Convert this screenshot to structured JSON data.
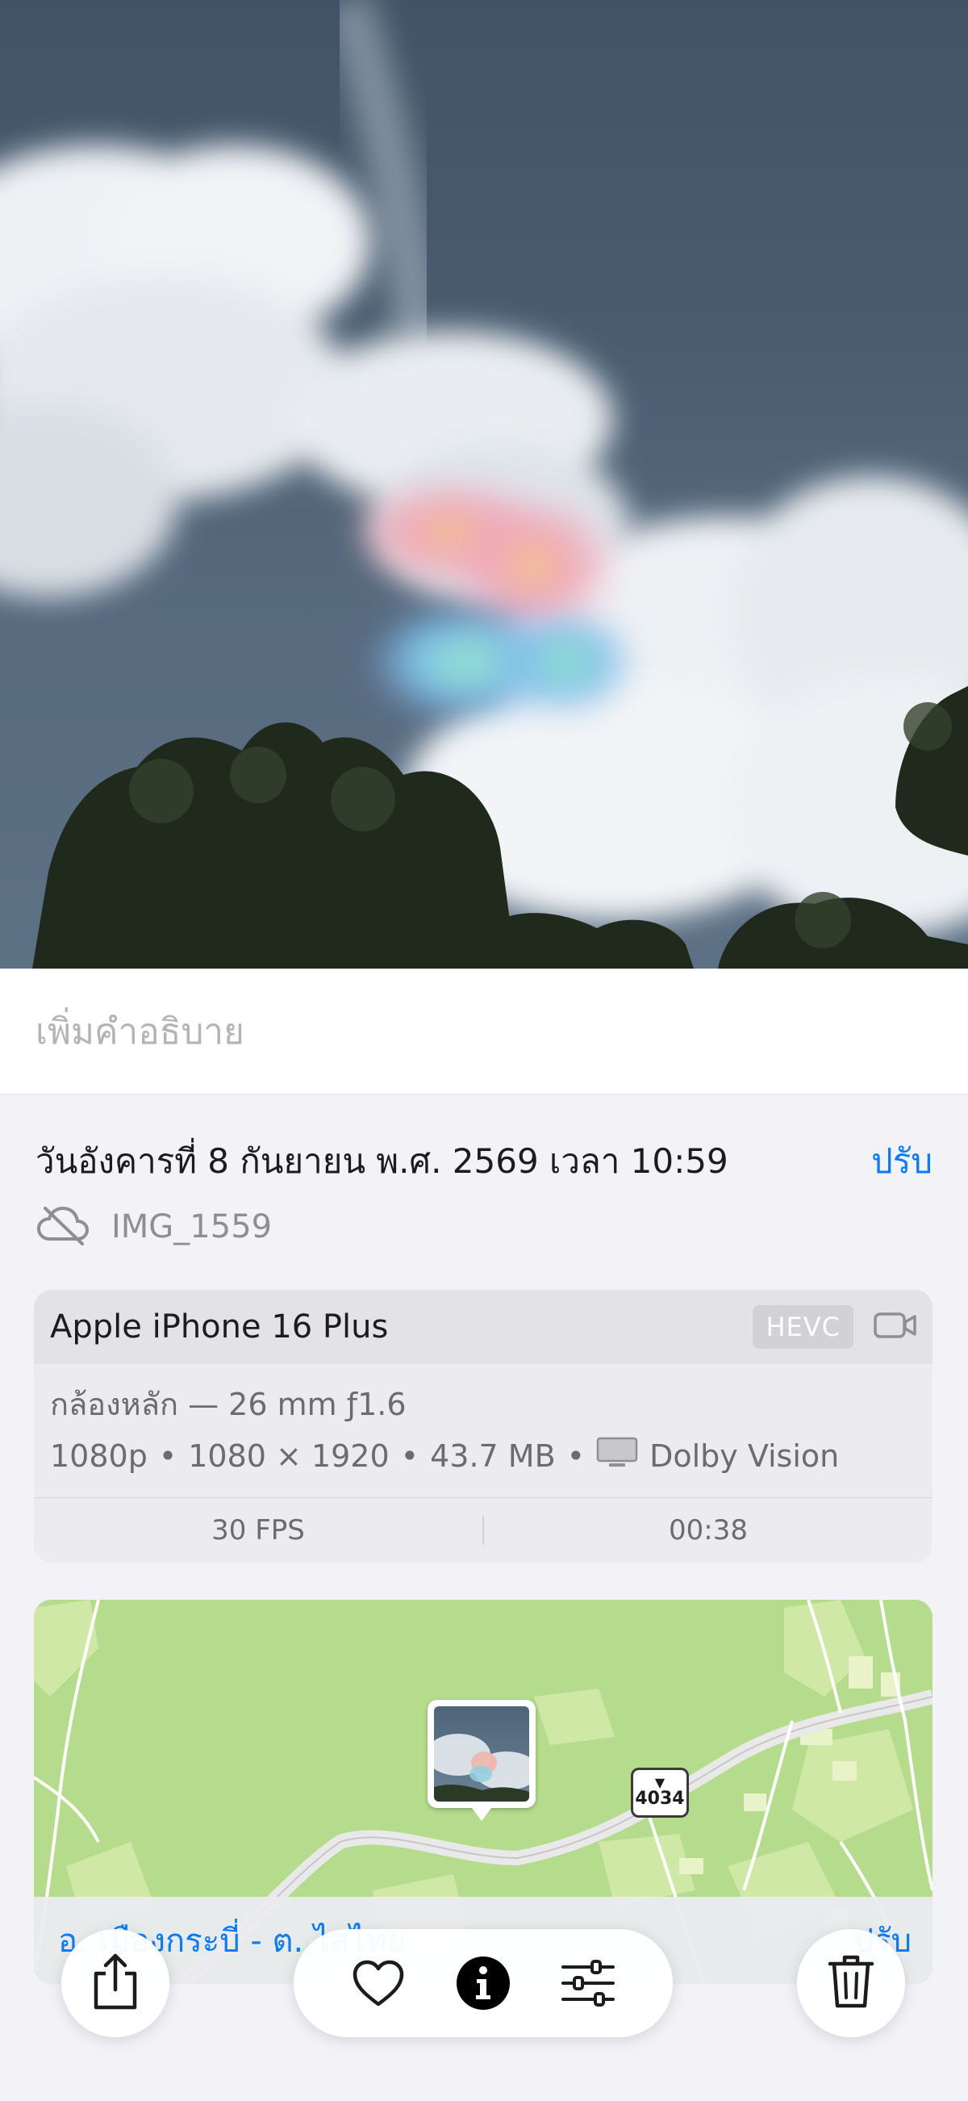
{
  "caption": {
    "placeholder": "เพิ่มคำอธิบาย"
  },
  "header": {
    "date": "วันอังคารที่ 8 กันยายน พ.ศ. 2569 เวลา 10:59",
    "adjust_label": "ปรับ",
    "filename": "IMG_1559",
    "cloud_icon": "cloud-slash-icon"
  },
  "camera": {
    "device": "Apple iPhone 16 Plus",
    "format_badge": "HEVC",
    "video_icon": "video-camera-icon",
    "lens": "กล้องหลัก — 26 mm ƒ1.6",
    "resolution": "1080p",
    "dimensions": "1080 × 1920",
    "size": "43.7 MB",
    "hdr": "Dolby Vision",
    "hdr_icon": "monitor-icon",
    "bullet": "•",
    "fps": "30 FPS",
    "duration": "00:38"
  },
  "map": {
    "road_number": "4034",
    "place": "อ. เมืองกระบี่ - ต. ไสไทย",
    "edit_label": "ปรับ"
  },
  "toolbar": {
    "share_icon": "share-icon",
    "favorite_icon": "heart-icon",
    "info_icon": "info-icon",
    "adjust_icon": "sliders-icon",
    "delete_icon": "trash-icon"
  },
  "colors": {
    "accent": "#0a7aff",
    "background": "#f2f2f7"
  }
}
